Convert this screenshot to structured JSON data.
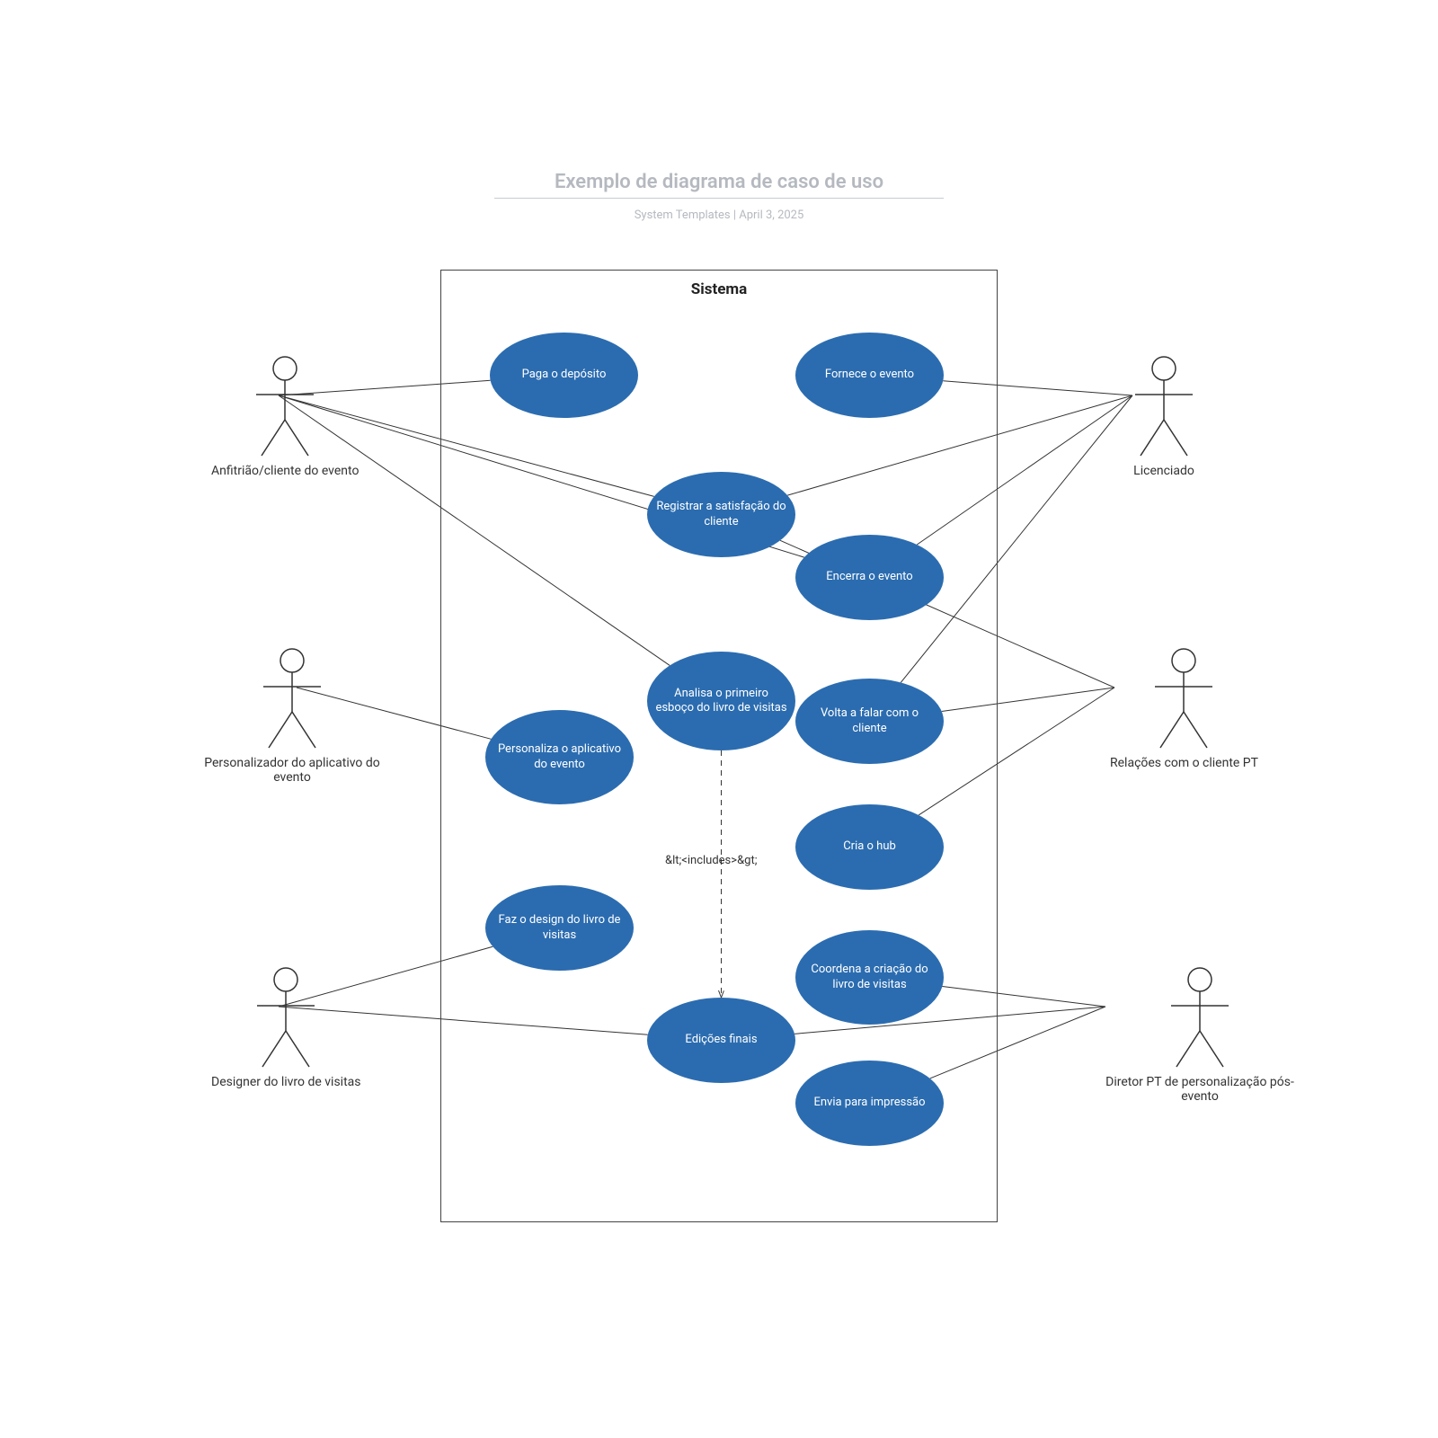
{
  "title": "Exemplo de diagrama de caso de uso",
  "subtitle_left": "System Templates",
  "subtitle_sep": "  |  ",
  "subtitle_right": "April 3, 2025",
  "system_label": "Sistema",
  "includes_label": "&lt;<includes>&gt;",
  "actors": {
    "host": {
      "label": "Anfitrião/cliente do evento"
    },
    "customizer": {
      "label": "Personalizador do aplicativo do evento"
    },
    "designer": {
      "label": "Designer do livro de visitas"
    },
    "licensee": {
      "label": "Licenciado"
    },
    "relations": {
      "label": "Relações com o cliente PT"
    },
    "director": {
      "label": "Diretor PT de personalização pós-evento"
    }
  },
  "usecases": {
    "pay_deposit": {
      "label": "Paga o depósito"
    },
    "provide_event": {
      "label": "Fornece o evento"
    },
    "register_sat": {
      "label": "Registrar a satisfação do cliente"
    },
    "close_event": {
      "label": "Encerra o evento"
    },
    "review_draft": {
      "label": "Analisa o primeiro esboço do livro de visitas"
    },
    "followup": {
      "label": "Volta a falar com o cliente"
    },
    "customize_app": {
      "label": "Personaliza o aplicativo do evento"
    },
    "create_hub": {
      "label": "Cria o hub"
    },
    "design_book": {
      "label": "Faz o design do livro de visitas"
    },
    "coord_book": {
      "label": "Coordena a criação do livro de visitas"
    },
    "final_edits": {
      "label": "Edições finais"
    },
    "send_print": {
      "label": "Envia para impressão"
    }
  },
  "links": [
    {
      "from": "host",
      "to": "pay_deposit"
    },
    {
      "from": "host",
      "to": "register_sat"
    },
    {
      "from": "host",
      "to": "review_draft"
    },
    {
      "from": "host",
      "to": "close_event"
    },
    {
      "from": "customizer",
      "to": "customize_app"
    },
    {
      "from": "designer",
      "to": "design_book"
    },
    {
      "from": "designer",
      "to": "final_edits"
    },
    {
      "from": "licensee",
      "to": "provide_event"
    },
    {
      "from": "licensee",
      "to": "register_sat"
    },
    {
      "from": "licensee",
      "to": "close_event"
    },
    {
      "from": "licensee",
      "to": "followup"
    },
    {
      "from": "relations",
      "to": "register_sat"
    },
    {
      "from": "relations",
      "to": "followup"
    },
    {
      "from": "relations",
      "to": "create_hub"
    },
    {
      "from": "director",
      "to": "coord_book"
    },
    {
      "from": "director",
      "to": "final_edits"
    },
    {
      "from": "director",
      "to": "send_print"
    }
  ],
  "dashed_link": {
    "from": "review_draft",
    "to": "final_edits"
  }
}
